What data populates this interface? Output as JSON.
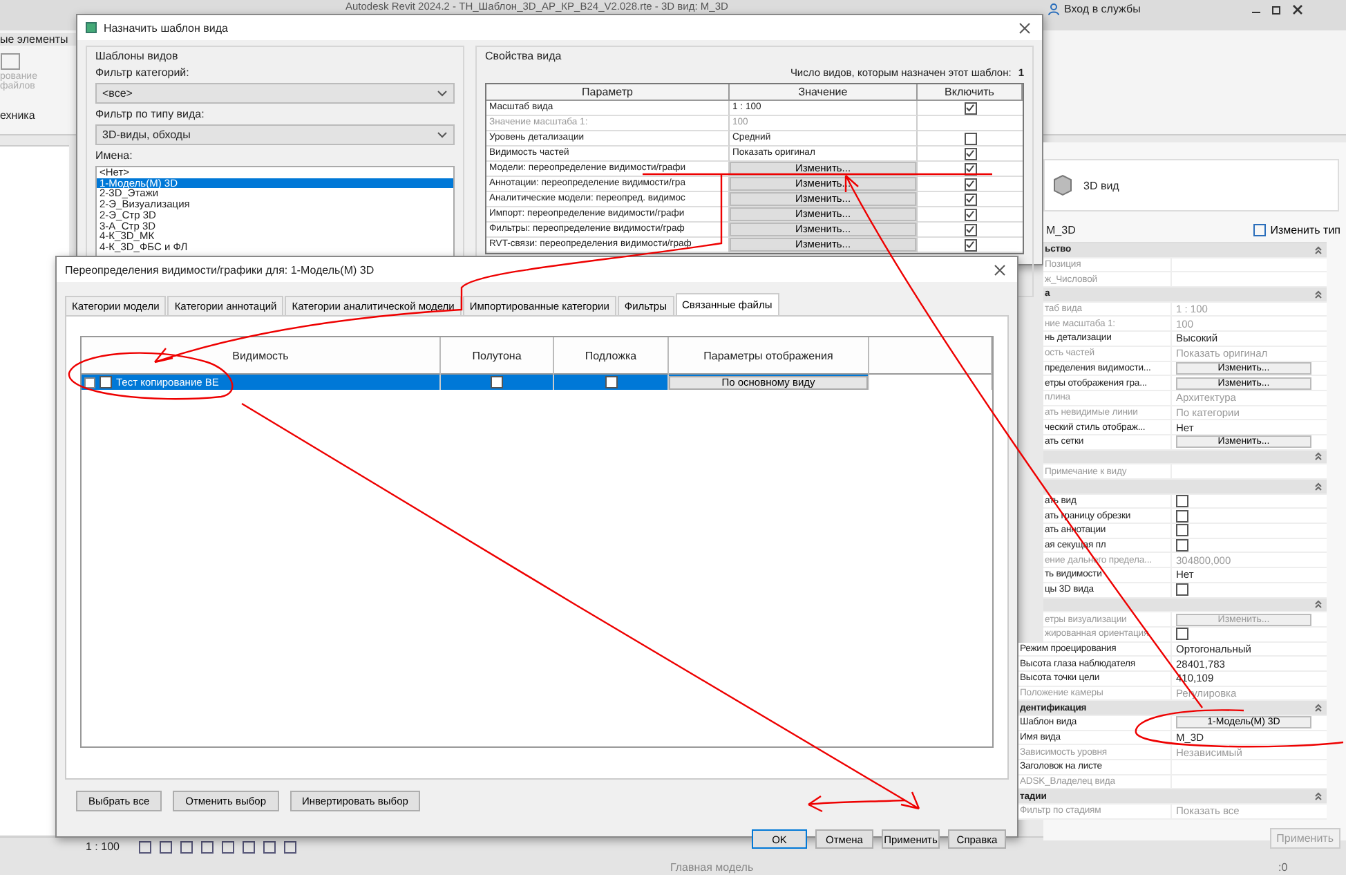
{
  "app": {
    "title": "Autodesk Revit 2024.2 - ТН_Шаблон_3D_АР_КР_В24_V2.028.rte - 3D вид: M_3D",
    "sign_in": "Вход в службы",
    "ribbon_panel": "ые элементы",
    "ribbon_button_lines": [
      "рование",
      "файлов"
    ],
    "ribbon_label": "ехника"
  },
  "assign_dialog": {
    "title": "Назначить шаблон вида",
    "templates_group": "Шаблоны видов",
    "category_filter_label": "Фильтр категорий:",
    "category_filter": "<все>",
    "type_filter_label": "Фильтр по типу вида:",
    "type_filter": "3D-виды, обходы",
    "names_label": "Имена:",
    "names": [
      {
        "label": "<Нет>",
        "selected": false
      },
      {
        "label": "1-Модель(М) 3D",
        "selected": true
      },
      {
        "label": "2-3D_Этажи",
        "selected": false
      },
      {
        "label": "2-Э_Визуализация",
        "selected": false
      },
      {
        "label": "2-Э_Стр 3D",
        "selected": false
      },
      {
        "label": "3-А_Стр 3D",
        "selected": false
      },
      {
        "label": "4-К_3D_МК",
        "selected": false
      },
      {
        "label": "4-К_3D_ФБС и ФЛ",
        "selected": false
      }
    ],
    "properties_group": "Свойства вида",
    "count_label": "Число видов, которым назначен этот шаблон:",
    "count": "1",
    "columns": [
      "Параметр",
      "Значение",
      "Включить"
    ],
    "rows": [
      {
        "parameter": "Масштаб вида",
        "value": "1 : 100",
        "kind": "text",
        "disabled": false,
        "include": true
      },
      {
        "parameter": "Значение масштаба    1:",
        "value": "100",
        "kind": "text",
        "disabled": true
      },
      {
        "parameter": "Уровень детализации",
        "value": "Средний",
        "kind": "text",
        "disabled": false,
        "include": false
      },
      {
        "parameter": "Видимость частей",
        "value": "Показать оригинал",
        "kind": "text",
        "disabled": false,
        "include": true
      },
      {
        "parameter": "Модели: переопределение видимости/графи",
        "value": "Изменить...",
        "kind": "button",
        "disabled": false,
        "include": true
      },
      {
        "parameter": "Аннотации: переопределение видимости/гра",
        "value": "Изменить...",
        "kind": "button",
        "disabled": false,
        "include": true
      },
      {
        "parameter": "Аналитические модели: переопред. видимос",
        "value": "Изменить...",
        "kind": "button",
        "disabled": false,
        "include": true
      },
      {
        "parameter": "Импорт: переопределение видимости/графи",
        "value": "Изменить...",
        "kind": "button",
        "disabled": false,
        "include": true
      },
      {
        "parameter": "Фильтры: переопределение видимости/граф",
        "value": "Изменить...",
        "kind": "button",
        "disabled": false,
        "include": true
      },
      {
        "parameter": "RVT-связи: переопределения видимости/граф",
        "value": "Изменить...",
        "kind": "button",
        "disabled": false,
        "include": true
      }
    ]
  },
  "properties": {
    "type_name": "3D вид",
    "instance": "M_3D",
    "edit_type": "Изменить тип",
    "rows": [
      {
        "kind": "section",
        "label": "ьство"
      },
      {
        "kind": "text",
        "label": "Позиция",
        "value": "",
        "disabled": true
      },
      {
        "kind": "text",
        "label": "ж_Числовой",
        "value": "",
        "disabled": true
      },
      {
        "kind": "section",
        "label": "а"
      },
      {
        "kind": "text",
        "label": "таб вида",
        "value": "1 : 100",
        "disabled": true
      },
      {
        "kind": "text",
        "label": "ние масштаба    1:",
        "value": "100",
        "disabled": true
      },
      {
        "kind": "text",
        "label": "нь детализации",
        "value": "Высокий",
        "disabled": false
      },
      {
        "kind": "text",
        "label": "ость частей",
        "value": "Показать оригинал",
        "disabled": true
      },
      {
        "kind": "button",
        "label": "пределения видимости...",
        "value": "Изменить...",
        "disabled": false
      },
      {
        "kind": "button",
        "label": "етры отображения гра...",
        "value": "Изменить...",
        "disabled": false
      },
      {
        "kind": "text",
        "label": "плина",
        "value": "Архитектура",
        "disabled": true
      },
      {
        "kind": "text",
        "label": "ать невидимые линии",
        "value": "По категории",
        "disabled": true
      },
      {
        "kind": "text",
        "label": "ческий стиль отображ...",
        "value": "Нет",
        "disabled": false
      },
      {
        "kind": "button",
        "label": "ать сетки",
        "value": "Изменить...",
        "disabled": false
      },
      {
        "kind": "section",
        "label": ""
      },
      {
        "kind": "text",
        "label": "Примечание к виду",
        "value": "",
        "disabled": true
      },
      {
        "kind": "section",
        "label": ""
      },
      {
        "kind": "checkbox",
        "label": "ать вид",
        "checked": false,
        "disabled": false
      },
      {
        "kind": "checkbox",
        "label": "ать границу обрезки",
        "checked": false,
        "disabled": false
      },
      {
        "kind": "checkbox",
        "label": "ать аннотации",
        "checked": false,
        "disabled": false
      },
      {
        "kind": "checkbox",
        "label": "ая секущая пл",
        "checked": false,
        "disabled": false
      },
      {
        "kind": "text",
        "label": "ение дальнего предела...",
        "value": "304800,000",
        "disabled": true
      },
      {
        "kind": "text",
        "label": "ть видимости",
        "value": "Нет",
        "disabled": false
      },
      {
        "kind": "checkbox",
        "label": "цы 3D вида",
        "checked": false,
        "disabled": false
      },
      {
        "kind": "section",
        "label": ""
      },
      {
        "kind": "button",
        "label": "етры визуализации",
        "value": "Изменить...",
        "disabled": true
      },
      {
        "kind": "checkbox",
        "label": "жированная ориентация",
        "checked": false,
        "disabled": true
      },
      {
        "kind": "text",
        "label": "Режим проецирования",
        "value": "Ортогональный",
        "disabled": false
      },
      {
        "kind": "text",
        "label": "Высота глаза наблюдателя",
        "value": "28401,783",
        "disabled": false
      },
      {
        "kind": "text",
        "label": "Высота точки цели",
        "value": "410,109",
        "disabled": false
      },
      {
        "kind": "text",
        "label": "Положение камеры",
        "value": "Регулировка",
        "disabled": true
      },
      {
        "kind": "section",
        "label": "дентификация"
      },
      {
        "kind": "button",
        "label": "Шаблон вида",
        "value": "1-Модель(М) 3D",
        "disabled": false
      },
      {
        "kind": "text",
        "label": "Имя вида",
        "value": "M_3D",
        "disabled": false
      },
      {
        "kind": "text",
        "label": "Зависимость уровня",
        "value": "Независимый",
        "disabled": true
      },
      {
        "kind": "text",
        "label": "Заголовок на листе",
        "value": "",
        "disabled": false
      },
      {
        "kind": "text",
        "label": "ADSK_Владелец вида",
        "value": "",
        "disabled": true
      },
      {
        "kind": "section",
        "label": "тадии"
      },
      {
        "kind": "text",
        "label": "Фильтр по стадиям",
        "value": "Показать все",
        "disabled": true
      }
    ],
    "apply": "Применить"
  },
  "override_dialog": {
    "title": "Переопределения видимости/графики для: 1-Модель(М) 3D",
    "tabs": [
      {
        "label": "Категории модели",
        "selected": false
      },
      {
        "label": "Категории аннотаций",
        "selected": false
      },
      {
        "label": "Категории аналитической модели",
        "selected": false
      },
      {
        "label": "Импортированные категории",
        "selected": false
      },
      {
        "label": "Фильтры",
        "selected": false
      },
      {
        "label": "Связанные файлы",
        "selected": true
      }
    ],
    "columns": [
      "Видимость",
      "Полутона",
      "Подложка",
      "Параметры отображения"
    ],
    "rows": [
      {
        "name": "Тест копирование ВЕ",
        "selected": true,
        "visible": false,
        "halftone": false,
        "underlay": false,
        "display": "По основному виду"
      }
    ],
    "selection_buttons": [
      "Выбрать все",
      "Отменить выбор",
      "Инвертировать выбор"
    ],
    "buttons": [
      {
        "label": "OK",
        "default": true
      },
      {
        "label": "Отмена",
        "default": false
      },
      {
        "label": "Применить",
        "default": false
      },
      {
        "label": "Справка",
        "default": false
      }
    ]
  },
  "status_bar": {
    "scale": "1 : 100",
    "model": "Главная модель",
    "count": ":0"
  }
}
